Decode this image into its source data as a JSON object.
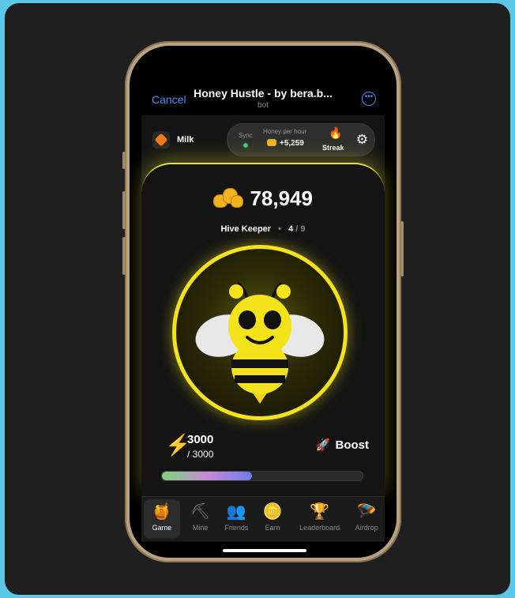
{
  "nav": {
    "cancel_label": "Cancel",
    "title": "Honey Hustle - by bera.b...",
    "subtitle": "bot",
    "more_icon": "more-icon"
  },
  "topbar": {
    "token_label": "Milk",
    "sync_label": "Sync",
    "sync_status_color": "#33d17a",
    "honey_per_hour_label": "Honey per hour",
    "honey_per_hour_value": "+5,259",
    "streak_label": "Streak"
  },
  "game": {
    "coins": "78,949",
    "level_name": "Hive Keeper",
    "level_current": "4",
    "level_separator": "/",
    "level_total": "9",
    "energy_current": "3000",
    "energy_max": "/ 3000",
    "energy_fill_fraction": 0.45,
    "boost_label": "Boost"
  },
  "colors": {
    "accent_yellow": "#f4e21a",
    "link_blue": "#4a90ff"
  },
  "tabs": [
    {
      "label": "Game",
      "icon": "honey-pot-icon",
      "active": true
    },
    {
      "label": "Mine",
      "icon": "pickaxe-icon",
      "active": false
    },
    {
      "label": "Friends",
      "icon": "friends-icon",
      "active": false
    },
    {
      "label": "Earn",
      "icon": "coins-icon",
      "active": false
    },
    {
      "label": "Leaderboard",
      "icon": "trophy-icon",
      "active": false
    },
    {
      "label": "Airdrop",
      "icon": "parachute-icon",
      "active": false
    }
  ]
}
